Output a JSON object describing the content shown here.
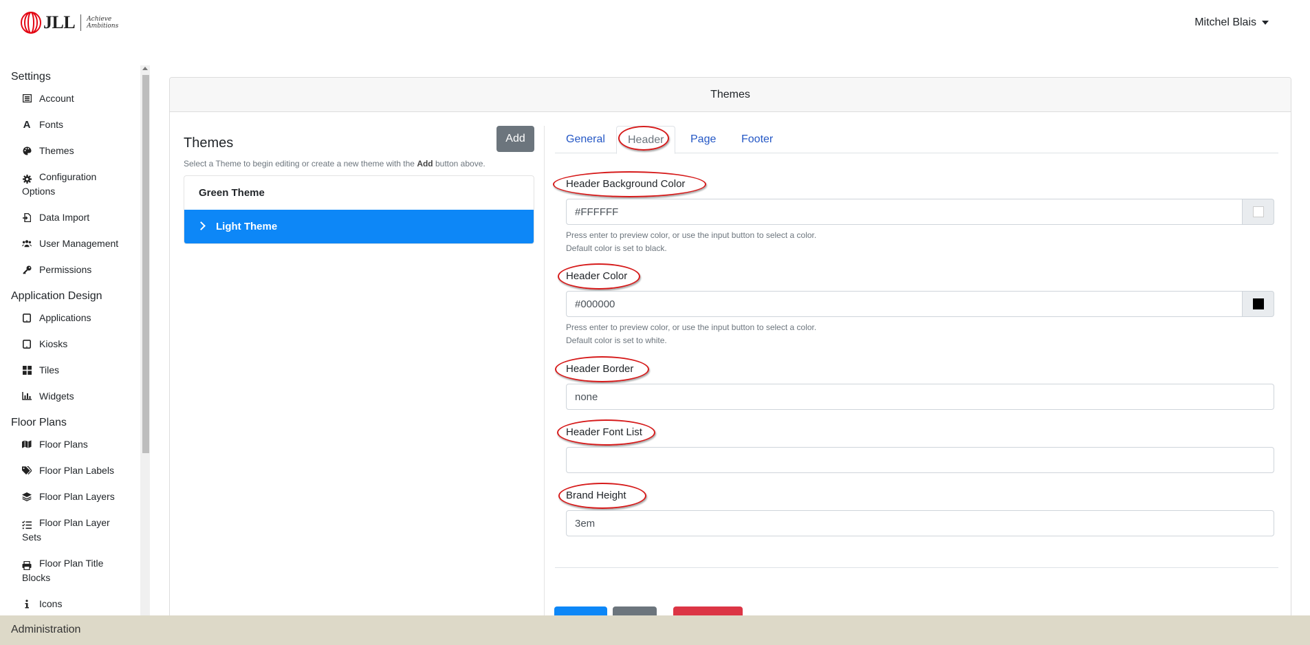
{
  "header": {
    "logo_text": "JLL",
    "logo_tagline_1": "Achieve",
    "logo_tagline_2": "Ambitions",
    "user_name": "Mitchel Blais"
  },
  "sidebar": {
    "sections": [
      {
        "title": "Settings",
        "items": [
          {
            "label": "Account",
            "icon": "account-icon"
          },
          {
            "label": "Fonts",
            "icon": "font-icon"
          },
          {
            "label": "Themes",
            "icon": "palette-icon"
          },
          {
            "label": "Configuration Options",
            "icon": "gear-icon"
          },
          {
            "label": "Data Import",
            "icon": "file-import-icon"
          },
          {
            "label": "User Management",
            "icon": "users-icon"
          },
          {
            "label": "Permissions",
            "icon": "key-icon"
          }
        ]
      },
      {
        "title": "Application Design",
        "items": [
          {
            "label": "Applications",
            "icon": "tablet-icon"
          },
          {
            "label": "Kiosks",
            "icon": "tablet-icon"
          },
          {
            "label": "Tiles",
            "icon": "grid-icon"
          },
          {
            "label": "Widgets",
            "icon": "chart-icon"
          }
        ]
      },
      {
        "title": "Floor Plans",
        "items": [
          {
            "label": "Floor Plans",
            "icon": "map-icon"
          },
          {
            "label": "Floor Plan Labels",
            "icon": "tags-icon"
          },
          {
            "label": "Floor Plan Layers",
            "icon": "layers-icon"
          },
          {
            "label": "Floor Plan Layer Sets",
            "icon": "list-check-icon"
          },
          {
            "label": "Floor Plan Title Blocks",
            "icon": "print-icon"
          },
          {
            "label": "Icons",
            "icon": "info-icon"
          }
        ]
      }
    ]
  },
  "card": {
    "title": "Themes"
  },
  "themes_panel": {
    "title": "Themes",
    "add_label": "Add",
    "help_pre": "Select a Theme to begin editing or create a new theme with the ",
    "help_bold": "Add",
    "help_post": " button above.",
    "items": [
      {
        "label": "Green Theme",
        "active": false
      },
      {
        "label": "Light Theme",
        "active": true
      }
    ]
  },
  "tabs": [
    "General",
    "Header",
    "Page",
    "Footer"
  ],
  "active_tab": "Header",
  "form": {
    "header_bg_label": "Header Background Color",
    "header_bg_value": "#FFFFFF",
    "header_bg_hint_1": "Press enter to preview color, or use the input button to select a color.",
    "header_bg_hint_2": "Default color is set to black.",
    "header_color_label": "Header Color",
    "header_color_value": "#000000",
    "header_color_hint_1": "Press enter to preview color, or use the input button to select a color.",
    "header_color_hint_2": "Default color is set to white.",
    "header_border_label": "Header Border",
    "header_border_value": "none",
    "header_font_label": "Header Font List",
    "header_font_value": "",
    "brand_height_label": "Brand Height",
    "brand_height_value": "3em"
  },
  "colors": {
    "active_item": "#0d87f7",
    "tab_link": "#2457c5",
    "annotation": "#d61a1a",
    "save_button": "#0d87f7",
    "reset_button": "#6c757d",
    "delete_button": "#dc3545",
    "footer_bg": "#ddd9c8"
  },
  "footer": {
    "label": "Administration"
  }
}
